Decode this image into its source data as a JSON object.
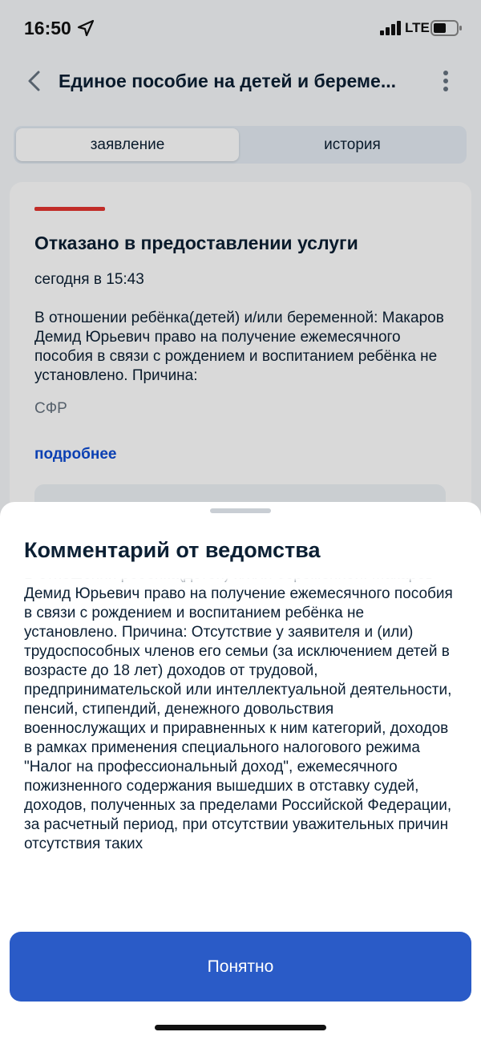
{
  "status_bar": {
    "time": "16:50",
    "network": "LTE",
    "icons": [
      "location-arrow-icon",
      "signal-icon",
      "battery-icon"
    ]
  },
  "header": {
    "title": "Единое пособие на детей и береме...",
    "back_icon": "chevron-left-icon",
    "menu_icon": "more-vertical-icon"
  },
  "tabs": [
    {
      "label": "заявление",
      "active": true
    },
    {
      "label": "история",
      "active": false
    }
  ],
  "card": {
    "accent_color": "#e3342f",
    "title": "Отказано в предоставлении услуги",
    "time": "сегодня в 15:43",
    "text": "В отношении ребёнка(детей) и/или беременной: Макаров Демид Юрьевич право на получение ежемесячного пособия в связи с рождением и воспитанием ребёнка не установлено. Причина:",
    "source": "СФР",
    "more_link": "подробнее"
  },
  "sheet": {
    "title": "Комментарий от ведомства",
    "text": "В отношении ребёнка(детей) и/или беременной: Макаров Демид Юрьевич право на получение ежемесячного пособия в связи с рождением и воспитанием ребёнка не установлено. Причина: Отсутствие у заявителя и (или) трудоспособных членов его семьи (за исключением детей в возрасте до 18 лет) доходов от трудовой, предпринимательской или интеллектуальной деятельности, пенсий, стипендий, денежного довольствия военнослужащих и приравненных к ним категорий, доходов в рамках применения специального налогового режима \"Налог на профессиональный доход\", ежемесячного пожизненного содержания вышедших в отставку судей, доходов, полученных за пределами Российской Федерации, за расчетный период, при отсутствии уважительных причин отсутствия таких",
    "button_label": "Понятно",
    "button_color": "#2a5bc7"
  }
}
